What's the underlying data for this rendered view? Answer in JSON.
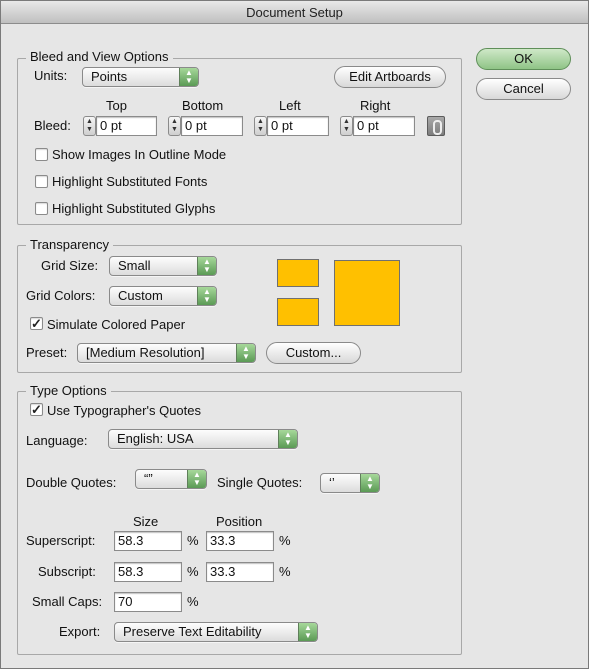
{
  "window": {
    "title": "Document Setup"
  },
  "buttons": {
    "ok": "OK",
    "cancel": "Cancel"
  },
  "bleed_view": {
    "group_title": "Bleed and View Options",
    "units_label": "Units:",
    "units_value": "Points",
    "edit_artboards": "Edit Artboards",
    "bleed_label": "Bleed:",
    "top_label": "Top",
    "bottom_label": "Bottom",
    "left_label": "Left",
    "right_label": "Right",
    "top_value": "0 pt",
    "bottom_value": "0 pt",
    "left_value": "0 pt",
    "right_value": "0 pt",
    "show_images_outline": "Show Images In Outline Mode",
    "highlight_fonts": "Highlight Substituted Fonts",
    "highlight_glyphs": "Highlight Substituted Glyphs"
  },
  "transparency": {
    "group_title": "Transparency",
    "grid_size_label": "Grid Size:",
    "grid_size_value": "Small",
    "grid_colors_label": "Grid Colors:",
    "grid_colors_value": "Custom",
    "simulate_paper": "Simulate Colored Paper",
    "preset_label": "Preset:",
    "preset_value": "[Medium Resolution]",
    "custom_button": "Custom...",
    "swatch_color": "#ffc000"
  },
  "type_options": {
    "group_title": "Type Options",
    "use_quotes": "Use Typographer's Quotes",
    "language_label": "Language:",
    "language_value": "English: USA",
    "double_quotes_label": "Double Quotes:",
    "double_quotes_value": "“”",
    "single_quotes_label": "Single Quotes:",
    "single_quotes_value": "‘’",
    "size_header": "Size",
    "position_header": "Position",
    "superscript_label": "Superscript:",
    "superscript_size": "58.3",
    "superscript_position": "33.3",
    "subscript_label": "Subscript:",
    "subscript_size": "58.3",
    "subscript_position": "33.3",
    "small_caps_label": "Small Caps:",
    "small_caps_value": "70",
    "percent": "%",
    "export_label": "Export:",
    "export_value": "Preserve Text Editability"
  },
  "checks": {
    "checked_glyph": "✓"
  }
}
